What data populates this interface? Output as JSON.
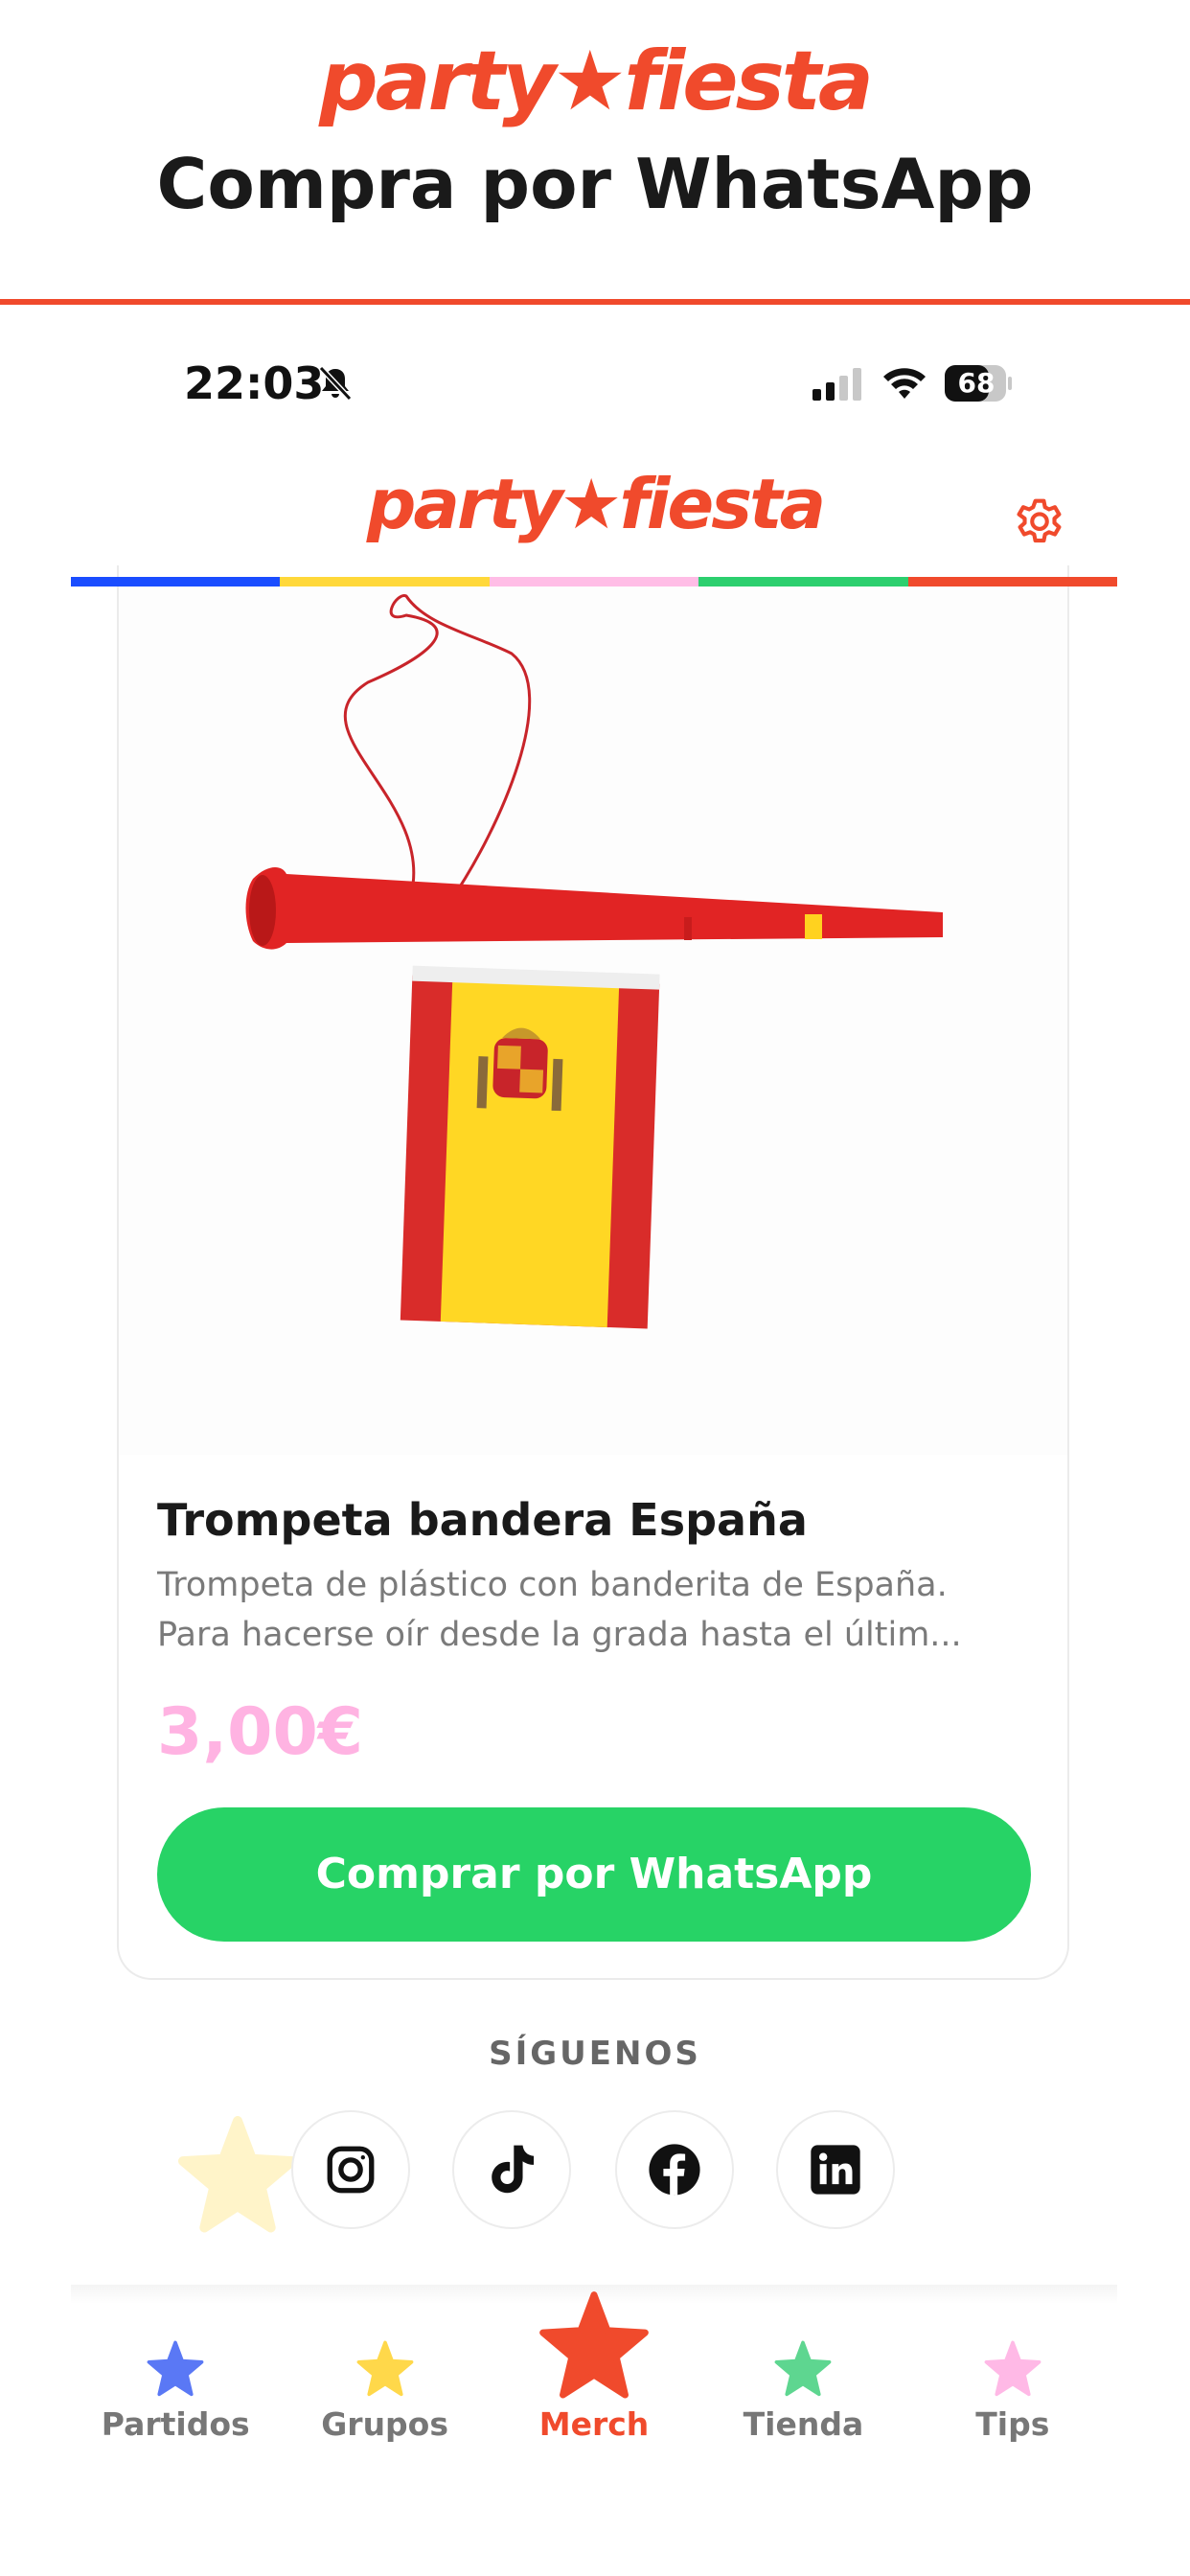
{
  "promo": {
    "logo_text": "party★fiesta",
    "title": "Compra por WhatsApp"
  },
  "status_bar": {
    "time": "22:03",
    "battery": "68",
    "icons": [
      "bell-slash-icon",
      "signal-icon",
      "wifi-icon",
      "battery-icon"
    ]
  },
  "header": {
    "logo_text": "party★fiesta",
    "settings_icon": "gear-icon",
    "stripe_colors": [
      "#1a4dff",
      "#ffd83a",
      "#ffbde6",
      "#2ccf6e",
      "#f04a2c"
    ]
  },
  "product": {
    "image_alt": "horn-with-spain-flag",
    "name": "Trompeta bandera España",
    "description_lines": [
      "Trompeta de plástico con banderita de España.",
      "Para hacerse oír desde la grada hasta el últim..."
    ],
    "price": "3,00€",
    "buy_button": "Comprar por WhatsApp"
  },
  "follow": {
    "title": "SÍGUENOS",
    "networks": [
      "instagram-icon",
      "tiktok-icon",
      "facebook-icon",
      "linkedin-icon"
    ]
  },
  "nav": {
    "items": [
      {
        "label": "Partidos",
        "color": "#5a78f5",
        "active": false
      },
      {
        "label": "Grupos",
        "color": "#ffd84a",
        "active": false
      },
      {
        "label": "Merch",
        "color": "#f04a2c",
        "active": true
      },
      {
        "label": "Tienda",
        "color": "#5ed690",
        "active": false
      },
      {
        "label": "Tips",
        "color": "#ffb9e6",
        "active": false
      }
    ]
  },
  "colors": {
    "brand": "#f04a2c",
    "whatsapp": "#27d366",
    "price": "#ffb3e2"
  }
}
